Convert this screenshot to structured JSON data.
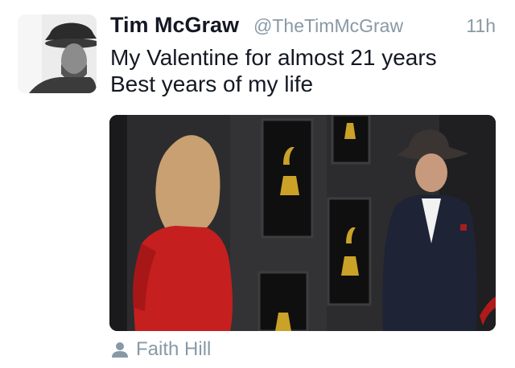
{
  "tweet": {
    "author_name": "Tim McGraw",
    "author_handle": "@TheTimMcGraw",
    "timestamp": "11h",
    "text_lines": [
      "My Valentine for almost 21 years",
      "Best years of my life"
    ],
    "tagged_user": "Faith Hill"
  },
  "icons": {
    "tag": "person-icon"
  },
  "colors": {
    "name": "#141823",
    "secondary": "#8899a6"
  }
}
